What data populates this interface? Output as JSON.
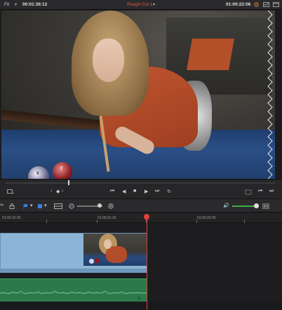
{
  "header": {
    "fit_label": "Fit",
    "source_timecode": "00:01:36:12",
    "timeline_name": "Rough Cut 1",
    "record_timecode": "01:00:22:06"
  },
  "viewer": {
    "ball_labels": [
      "9",
      "7"
    ]
  },
  "timeline": {
    "ruler_timecodes": [
      "01:00:15:20",
      "01:00:21:10",
      "01:00:26:00"
    ]
  },
  "icons": {
    "header": [
      "chevron-down-icon",
      "color-wheel-icon",
      "scope-icon",
      "window-layout-icon"
    ],
    "transport": [
      "view-options-icon",
      "jump-start-icon",
      "reverse-play-icon",
      "stop-icon",
      "play-icon",
      "jump-end-icon",
      "loop-icon",
      "match-frame-icon",
      "prev-edit-icon",
      "next-edit-icon"
    ],
    "toolbar": [
      "link-icon",
      "lock-icon",
      "flag-icon",
      "marker-icon",
      "timeline-view-icon",
      "zoom-out-icon",
      "zoom-in-icon",
      "audio-volume-icon",
      "mixer-icon"
    ]
  },
  "colors": {
    "timeline_name": "#e05a4c",
    "playhead": "#e0403a",
    "video_clip": "#8cb4d6",
    "audio_clip": "#2c7a4a",
    "volume_slider": "#3cb043"
  }
}
